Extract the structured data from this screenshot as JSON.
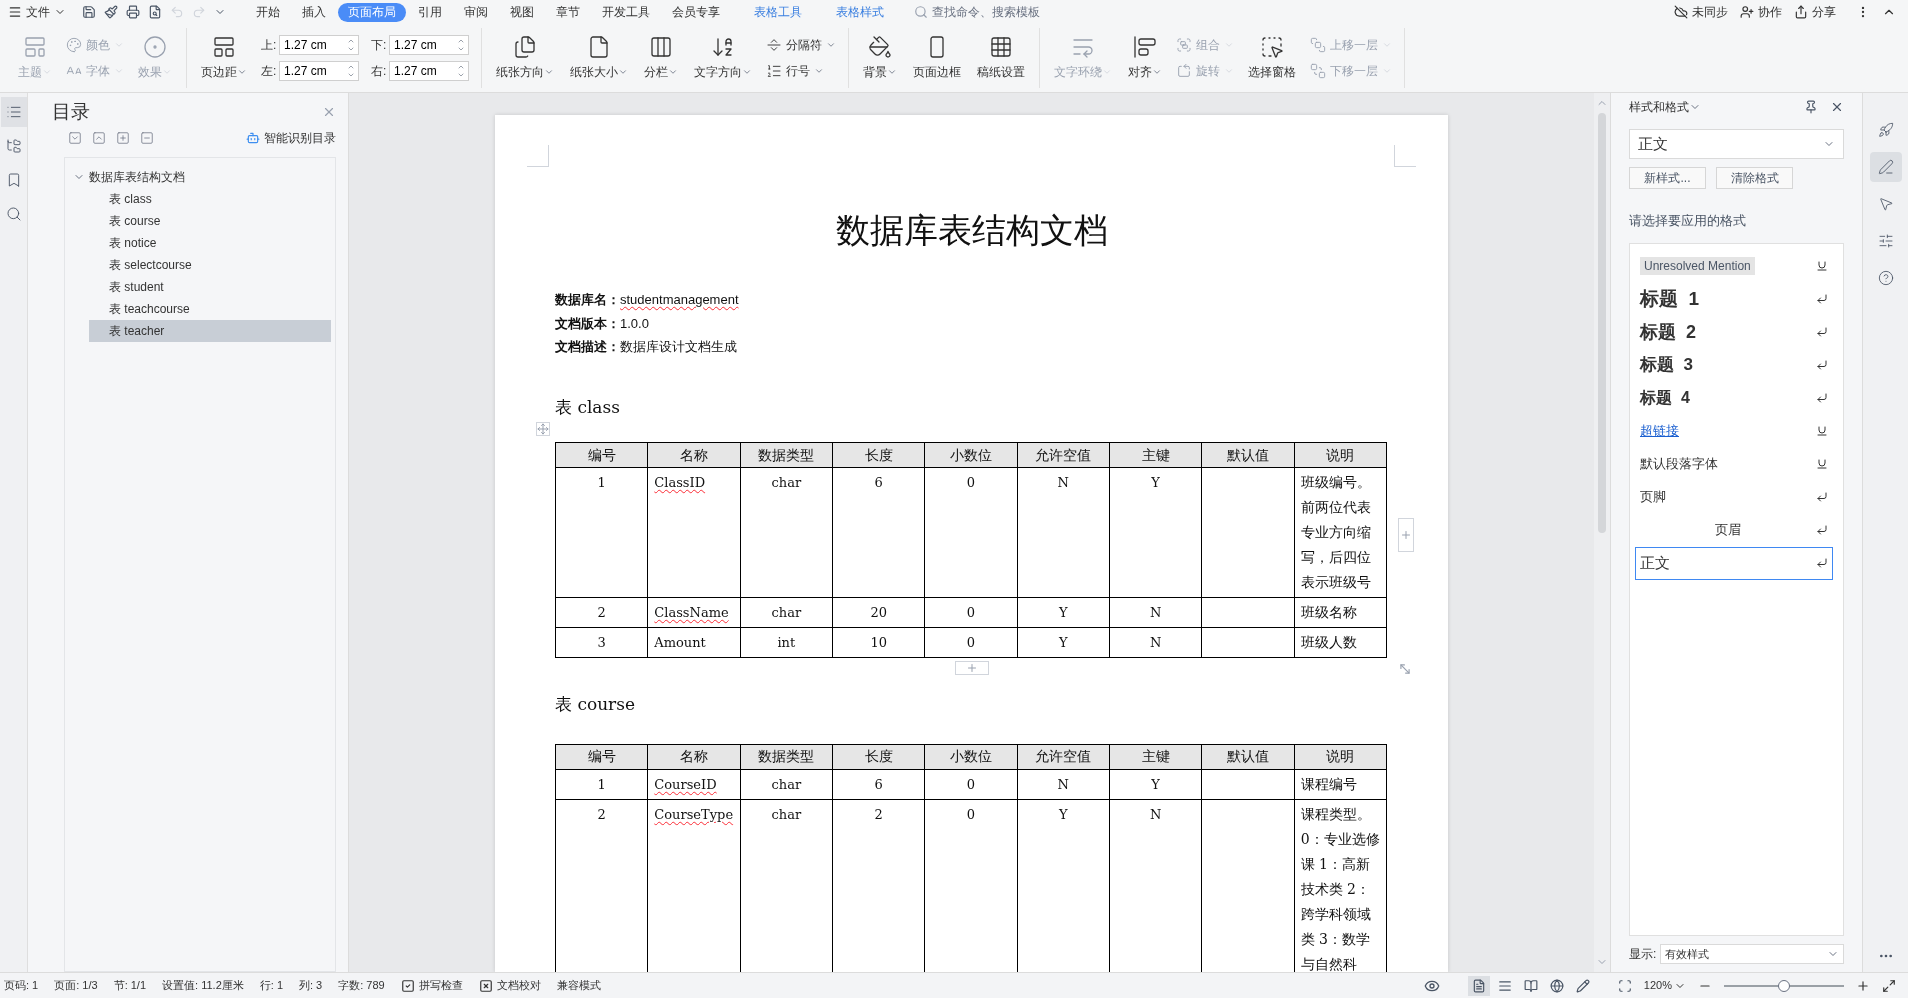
{
  "menu": {
    "file_label": "文件",
    "tabs": [
      {
        "label": "开始",
        "selected": false,
        "kind": "normal"
      },
      {
        "label": "插入",
        "selected": false,
        "kind": "normal"
      },
      {
        "label": "页面布局",
        "selected": true,
        "kind": "normal"
      },
      {
        "label": "引用",
        "selected": false,
        "kind": "normal"
      },
      {
        "label": "审阅",
        "selected": false,
        "kind": "normal"
      },
      {
        "label": "视图",
        "selected": false,
        "kind": "normal"
      },
      {
        "label": "章节",
        "selected": false,
        "kind": "normal"
      },
      {
        "label": "开发工具",
        "selected": false,
        "kind": "normal"
      },
      {
        "label": "会员专享",
        "selected": false,
        "kind": "normal"
      },
      {
        "label": "表格工具",
        "selected": false,
        "kind": "context"
      },
      {
        "label": "表格样式",
        "selected": false,
        "kind": "context"
      }
    ],
    "search": {
      "placeholder": "查找命令、搜索模板"
    },
    "actions": [
      "未同步",
      "协作",
      "分享"
    ]
  },
  "ribbon": {
    "groups": [
      {
        "items": [
          {
            "kind": "large",
            "label": "主题",
            "disabled": true,
            "dropdown": true
          },
          {
            "kind": "stack",
            "items": [
              {
                "label": "颜色",
                "disabled": true,
                "dropdown": true
              },
              {
                "label": "字体",
                "disabled": true,
                "dropdown": true
              }
            ]
          },
          {
            "kind": "large",
            "label": "效果",
            "disabled": true,
            "dropdown": true
          }
        ]
      },
      {
        "items": [
          {
            "kind": "large",
            "label": "页边距",
            "disabled": false,
            "dropdown": true
          },
          {
            "kind": "spins",
            "fields": [
              {
                "label": "上:",
                "value": "1.27 cm"
              },
              {
                "label": "左:",
                "value": "1.27 cm"
              }
            ]
          },
          {
            "kind": "spins",
            "fields": [
              {
                "label": "下:",
                "value": "1.27 cm"
              },
              {
                "label": "右:",
                "value": "1.27 cm"
              }
            ]
          }
        ]
      },
      {
        "items": [
          {
            "kind": "large",
            "label": "纸张方向",
            "disabled": false,
            "dropdown": true
          },
          {
            "kind": "large",
            "label": "纸张大小",
            "disabled": false,
            "dropdown": true
          },
          {
            "kind": "large",
            "label": "分栏",
            "disabled": false,
            "dropdown": true
          },
          {
            "kind": "large",
            "label": "文字方向",
            "disabled": false,
            "dropdown": true
          },
          {
            "kind": "stack",
            "items": [
              {
                "label": "分隔符",
                "disabled": false,
                "dropdown": true
              },
              {
                "label": "行号",
                "disabled": false,
                "dropdown": true
              }
            ]
          }
        ]
      },
      {
        "items": [
          {
            "kind": "large",
            "label": "背景",
            "disabled": false,
            "dropdown": true
          },
          {
            "kind": "large",
            "label": "页面边框",
            "disabled": false,
            "dropdown": false
          },
          {
            "kind": "large",
            "label": "稿纸设置",
            "disabled": false,
            "dropdown": false
          }
        ]
      },
      {
        "items": [
          {
            "kind": "large",
            "label": "文字环绕",
            "disabled": true,
            "dropdown": true
          },
          {
            "kind": "large",
            "label": "对齐",
            "disabled": false,
            "dropdown": true
          },
          {
            "kind": "stack",
            "items": [
              {
                "label": "组合",
                "disabled": true,
                "dropdown": true
              },
              {
                "label": "旋转",
                "disabled": true,
                "dropdown": true
              }
            ]
          },
          {
            "kind": "large",
            "label": "选择窗格",
            "disabled": false,
            "dropdown": false
          },
          {
            "kind": "stack",
            "items": [
              {
                "label": "上移一层",
                "disabled": true,
                "dropdown": true
              },
              {
                "label": "下移一层",
                "disabled": true,
                "dropdown": true
              }
            ]
          }
        ]
      }
    ]
  },
  "left_strip": [
    {
      "selected": true
    },
    {
      "selected": false
    },
    {
      "selected": false
    },
    {
      "selected": false
    }
  ],
  "nav": {
    "title": "目录",
    "smart_label": "智能识别目录",
    "tree": [
      {
        "label": "数据库表结构文档",
        "expanded": true,
        "selected": false,
        "children": [
          {
            "label": "表 class",
            "selected": false
          },
          {
            "label": "表 course",
            "selected": false
          },
          {
            "label": "表 notice",
            "selected": false
          },
          {
            "label": "表 selectcourse",
            "selected": false
          },
          {
            "label": "表 student",
            "selected": false
          },
          {
            "label": "表 teachcourse",
            "selected": false
          },
          {
            "label": "表 teacher",
            "selected": true
          }
        ]
      }
    ]
  },
  "document": {
    "title": "数据库表结构文档",
    "meta": [
      {
        "label": "数据库名：",
        "value": "studentmanagement",
        "spell_flag": true
      },
      {
        "label": "文档版本：",
        "value": "1.0.0",
        "spell_flag": false
      },
      {
        "label": "文档描述：",
        "value": "数据库设计文档生成",
        "spell_flag": false
      }
    ],
    "sections": [
      {
        "heading": "表 class",
        "active": true,
        "columns": [
          "编号",
          "名称",
          "数据类型",
          "长度",
          "小数位",
          "允许空值",
          "主键",
          "默认值",
          "说明"
        ],
        "rows": [
          {
            "cells": [
              "1",
              "ClassID",
              "char",
              "6",
              "0",
              "N",
              "Y",
              "",
              "班级编号。前两位代表专业方向缩写，后四位表示班级号"
            ],
            "spell_flag": true
          },
          {
            "cells": [
              "2",
              "ClassName",
              "char",
              "20",
              "0",
              "Y",
              "N",
              "",
              "班级名称"
            ],
            "spell_flag": true
          },
          {
            "cells": [
              "3",
              "Amount",
              "int",
              "10",
              "0",
              "Y",
              "N",
              "",
              "班级人数"
            ],
            "spell_flag": false
          }
        ]
      },
      {
        "heading": "表 course",
        "active": false,
        "columns": [
          "编号",
          "名称",
          "数据类型",
          "长度",
          "小数位",
          "允许空值",
          "主键",
          "默认值",
          "说明"
        ],
        "rows": [
          {
            "cells": [
              "1",
              "CourseID",
              "char",
              "6",
              "0",
              "N",
              "Y",
              "",
              "课程编号"
            ],
            "spell_flag": true
          },
          {
            "cells": [
              "2",
              "CourseType",
              "char",
              "2",
              "0",
              "Y",
              "N",
              "",
              "课程类型。 0：专业选修课 1：高新技术类 2：跨学科领域类 3：数学与自然科"
            ],
            "spell_flag": true
          }
        ]
      }
    ]
  },
  "styles_panel": {
    "title": "样式和格式",
    "current": "正文",
    "buttons": [
      "新样式...",
      "清除格式"
    ],
    "prompt": "请选择要应用的格式",
    "styles": [
      {
        "label": "Unresolved Mention",
        "kind": "mention",
        "paragraph_style": false,
        "selected": false
      },
      {
        "label": "标题  1",
        "kind": "h1",
        "paragraph_style": true,
        "selected": false
      },
      {
        "label": "标题  2",
        "kind": "h2",
        "paragraph_style": true,
        "selected": false
      },
      {
        "label": "标题  3",
        "kind": "h3",
        "paragraph_style": true,
        "selected": false
      },
      {
        "label": "标题  4",
        "kind": "h4",
        "paragraph_style": true,
        "selected": false
      },
      {
        "label": "超链接",
        "kind": "link",
        "paragraph_style": false,
        "selected": false
      },
      {
        "label": "默认段落字体",
        "kind": "plain",
        "paragraph_style": false,
        "selected": false
      },
      {
        "label": "页脚",
        "kind": "plain",
        "paragraph_style": true,
        "selected": false
      },
      {
        "label": "页眉",
        "kind": "centered",
        "paragraph_style": true,
        "selected": false
      },
      {
        "label": "正文",
        "kind": "body",
        "paragraph_style": true,
        "selected": true
      }
    ],
    "show_label": "显示:",
    "show_value": "有效样式"
  },
  "right_strip": [
    {
      "selected": false
    },
    {
      "selected": true
    },
    {
      "selected": false
    },
    {
      "selected": false
    },
    {
      "selected": false
    }
  ],
  "status_bar": {
    "items": [
      {
        "label": "页码: 1",
        "kind": "text"
      },
      {
        "label": "页面: 1/3",
        "kind": "text"
      },
      {
        "label": "节: 1/1",
        "kind": "text"
      },
      {
        "label": "设置值: 11.2厘米",
        "kind": "text"
      },
      {
        "label": "行: 1",
        "kind": "text"
      },
      {
        "label": "列: 3",
        "kind": "text"
      },
      {
        "label": "字数: 789",
        "kind": "text"
      },
      {
        "label": "拼写检查",
        "kind": "check"
      },
      {
        "label": "文档校对",
        "kind": "proof"
      },
      {
        "label": "兼容模式",
        "kind": "text"
      }
    ],
    "views": [
      {
        "selected": true
      },
      {
        "selected": false
      },
      {
        "selected": false
      },
      {
        "selected": false
      }
    ],
    "zoom": "120%",
    "zoom_slider": {
      "level": 0.5
    }
  }
}
